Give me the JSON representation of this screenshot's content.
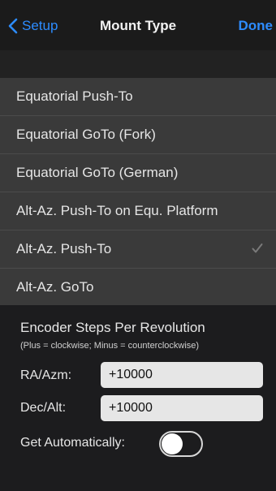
{
  "nav": {
    "back_label": "Setup",
    "title": "Mount Type",
    "done_label": "Done",
    "accent": "#2d8cff"
  },
  "mount_types": [
    {
      "label": "Equatorial Push-To",
      "selected": false
    },
    {
      "label": "Equatorial GoTo (Fork)",
      "selected": false
    },
    {
      "label": "Equatorial GoTo (German)",
      "selected": false
    },
    {
      "label": "Alt-Az. Push-To on Equ. Platform",
      "selected": false
    },
    {
      "label": "Alt-Az. Push-To",
      "selected": true
    },
    {
      "label": "Alt-Az. GoTo",
      "selected": false
    }
  ],
  "encoder": {
    "title": "Encoder Steps Per Revolution",
    "subtitle": "(Plus = clockwise; Minus = counterclockwise)",
    "ra_label": "RA/Azm:",
    "ra_value": "+10000",
    "dec_label": "Dec/Alt:",
    "dec_value": "+10000",
    "auto_label": "Get Automatically:",
    "auto_on": false
  }
}
